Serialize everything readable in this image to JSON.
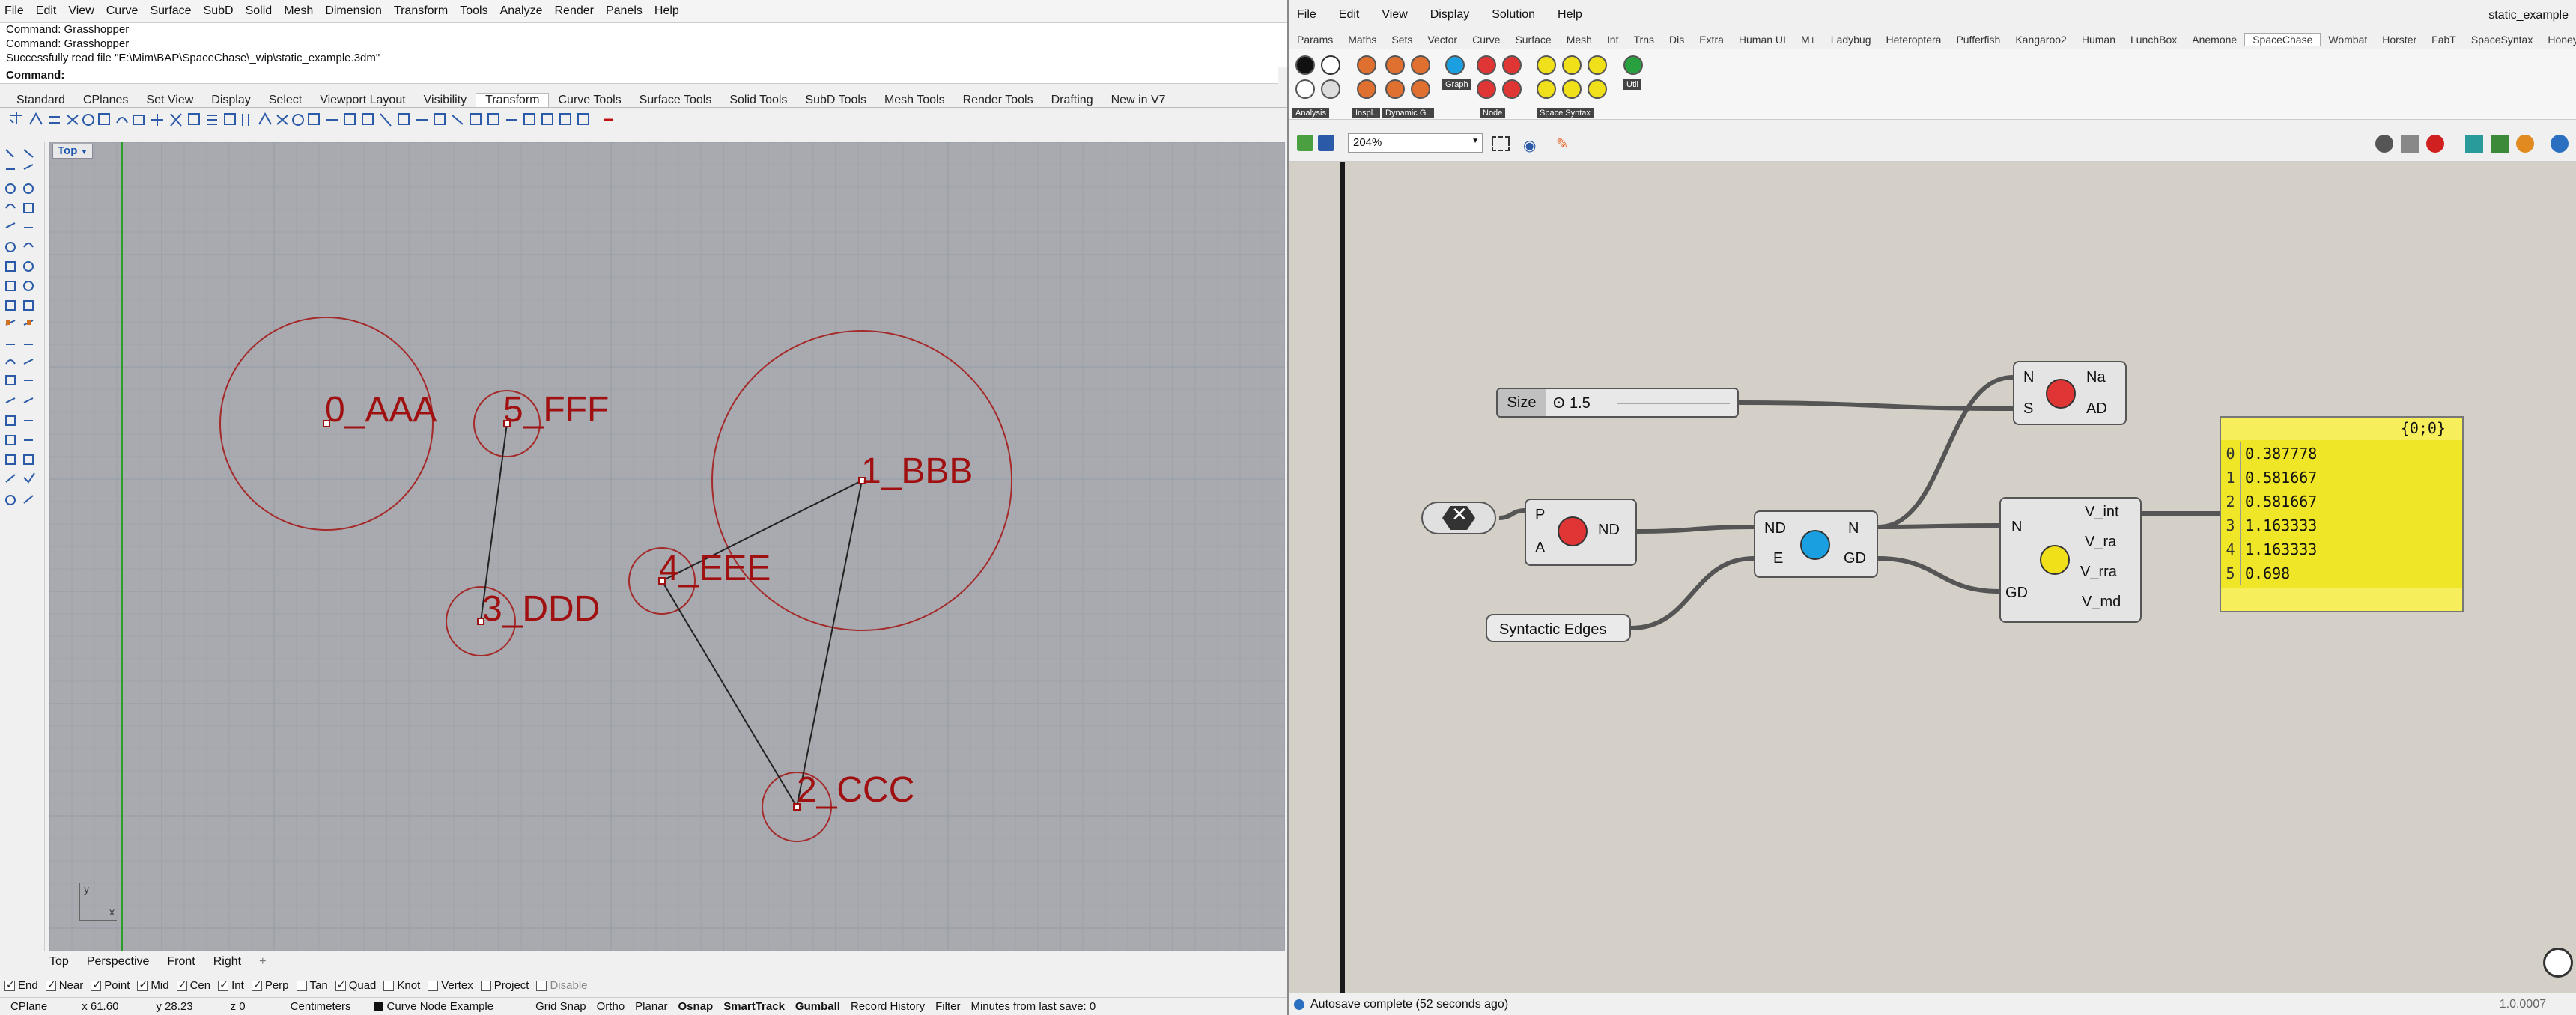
{
  "rhino": {
    "menu": [
      "File",
      "Edit",
      "View",
      "Curve",
      "Surface",
      "SubD",
      "Solid",
      "Mesh",
      "Dimension",
      "Transform",
      "Tools",
      "Analyze",
      "Render",
      "Panels",
      "Help"
    ],
    "history": [
      "Command: Grasshopper",
      "Command: Grasshopper",
      "Successfully read file \"E:\\Mim\\BAP\\SpaceChase\\_wip\\static_example.3dm\""
    ],
    "command_prompt": "Command:",
    "tabs": [
      "Standard",
      "CPlanes",
      "Set View",
      "Display",
      "Select",
      "Viewport Layout",
      "Visibility",
      "Transform",
      "Curve Tools",
      "Surface Tools",
      "Solid Tools",
      "SubD Tools",
      "Mesh Tools",
      "Render Tools",
      "Drafting",
      "New in V7"
    ],
    "active_tab": "Transform",
    "viewport_name": "Top",
    "axis_y": "y",
    "axis_x": "x",
    "nodes": [
      {
        "label": "0_AAA"
      },
      {
        "label": "5_FFF"
      },
      {
        "label": "1_BBB"
      },
      {
        "label": "4_EEE"
      },
      {
        "label": "3_DDD"
      },
      {
        "label": "2_CCC"
      }
    ],
    "viewport_tabs": [
      "Top",
      "Perspective",
      "Front",
      "Right"
    ],
    "viewport_tab_add": "+",
    "osnaps": [
      {
        "label": "End",
        "on": true
      },
      {
        "label": "Near",
        "on": true
      },
      {
        "label": "Point",
        "on": true
      },
      {
        "label": "Mid",
        "on": true
      },
      {
        "label": "Cen",
        "on": true
      },
      {
        "label": "Int",
        "on": true
      },
      {
        "label": "Perp",
        "on": true
      },
      {
        "label": "Tan",
        "on": false
      },
      {
        "label": "Quad",
        "on": true
      },
      {
        "label": "Knot",
        "on": false
      },
      {
        "label": "Vertex",
        "on": false
      },
      {
        "label": "Project",
        "on": false
      },
      {
        "label": "Disable",
        "on": false
      }
    ],
    "status": {
      "cplane": "CPlane",
      "x": "x 61.60",
      "y": "y 28.23",
      "z": "z 0",
      "units": "Centimeters",
      "layer": "Curve Node Example",
      "grid_snap": "Grid Snap",
      "ortho": "Ortho",
      "planar": "Planar",
      "osnap": "Osnap",
      "smarttrack": "SmartTrack",
      "gumball": "Gumball",
      "record_history": "Record History",
      "filter": "Filter",
      "save_info": "Minutes from last save: 0"
    }
  },
  "gh": {
    "menu": [
      "File",
      "Edit",
      "View",
      "Display",
      "Solution",
      "Help"
    ],
    "doc_name": "static_example",
    "tabs": [
      "Params",
      "Maths",
      "Sets",
      "Vector",
      "Curve",
      "Surface",
      "Mesh",
      "Int",
      "Trns",
      "Dis",
      "Extra",
      "Human UI",
      "M+",
      "Ladybug",
      "Heteroptera",
      "Pufferfish",
      "Kangaroo2",
      "Human",
      "LunchBox",
      "Anemone",
      "SpaceChase",
      "Wombat",
      "Horster",
      "FabT",
      "SpaceSyntax",
      "Honeybee"
    ],
    "active_tab": "SpaceChase",
    "ribbon_groups": [
      "Analysis",
      "Inspl..",
      "Dynamic G..",
      "Graph",
      "Node",
      "Space Syntax",
      "Util"
    ],
    "zoom": "204%",
    "slider": {
      "label": "Size",
      "value": "1.5"
    },
    "components": {
      "clear": {
        "inputs": [],
        "outputs": []
      },
      "pnd": {
        "inputs": [
          "P",
          "A"
        ],
        "outputs": [
          "ND"
        ]
      },
      "graph": {
        "inputs": [
          "ND",
          "E"
        ],
        "outputs": [
          "N",
          "GD"
        ]
      },
      "node": {
        "inputs": [
          "N",
          "S"
        ],
        "outputs": [
          "Na",
          "AD"
        ]
      },
      "syntax": {
        "inputs": [
          "N",
          "GD"
        ],
        "outputs": [
          "V_int",
          "V_ra",
          "V_rra",
          "V_md"
        ]
      }
    },
    "edges_param": "Syntactic Edges",
    "panel": {
      "path": "{0;0}",
      "rows": [
        {
          "i": "0",
          "v": "0.387778"
        },
        {
          "i": "1",
          "v": "0.581667"
        },
        {
          "i": "2",
          "v": "0.581667"
        },
        {
          "i": "3",
          "v": "1.163333"
        },
        {
          "i": "4",
          "v": "1.163333"
        },
        {
          "i": "5",
          "v": "0.698"
        }
      ]
    },
    "status": "Autosave complete (52 seconds ago)",
    "version": "1.0.0007",
    "colors": {
      "red": "#e03535",
      "blue": "#1aa0e0",
      "yellow": "#f0e01a",
      "panel": "#f6ee5a",
      "canvas": "#d4d0c8"
    }
  }
}
